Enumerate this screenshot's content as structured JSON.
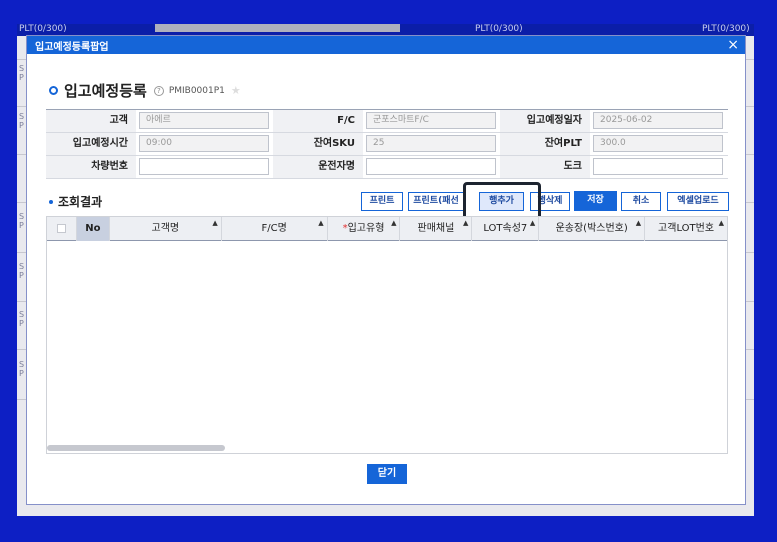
{
  "background": {
    "plt_labels": [
      "PLT(0/300)",
      "PLT(0/300)",
      "PLT(0/300)"
    ],
    "side_labels": [
      "S\nP",
      "S\nP",
      "S\nP",
      "S\nP",
      "S\nP",
      "S\nP"
    ]
  },
  "modal": {
    "title": "입고예정등록팝업",
    "close_label": "×"
  },
  "header": {
    "title": "입고예정등록",
    "help_icon": "?",
    "program_id": "PMIB0001P1",
    "favorite_icon": "★"
  },
  "form": {
    "rows": [
      [
        {
          "label": "고객",
          "value": "아에르"
        },
        {
          "label": "F/C",
          "value": "군포스마트F/C"
        },
        {
          "label": "입고예정일자",
          "value": "2025-06-02"
        }
      ],
      [
        {
          "label": "입고예정시간",
          "value": "09:00"
        },
        {
          "label": "잔여SKU",
          "value": "25"
        },
        {
          "label": "잔여PLT",
          "value": "300.0"
        }
      ],
      [
        {
          "label": "차량번호",
          "value": ""
        },
        {
          "label": "운전자명",
          "value": ""
        },
        {
          "label": "도크",
          "value": ""
        }
      ]
    ]
  },
  "results": {
    "title": "조회결과",
    "buttons": {
      "print": "프린트",
      "print_pallet": "프린트(패선",
      "add_row": "행추가",
      "delete_row": "행삭제",
      "save": "저장",
      "cancel": "취소",
      "excel_upload": "엑셀업로드"
    }
  },
  "grid": {
    "columns": [
      "No",
      "고객명",
      "F/C명",
      "입고유형",
      "판매채널",
      "LOT속성7",
      "운송장(박스번호)",
      "고객LOT번호"
    ],
    "required_mark": "*",
    "rows": []
  },
  "footer": {
    "close_button": "닫기"
  },
  "colors": {
    "background": "#0d1fc4",
    "titlebar": "#1565d8",
    "accent": "#1565d8"
  }
}
